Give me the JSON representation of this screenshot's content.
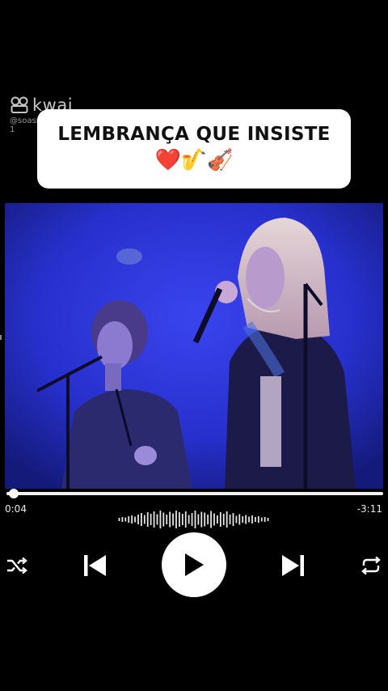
{
  "watermark": {
    "brand": "kwai",
    "handle": "@soasmusicasquemar...",
    "line2": "1"
  },
  "title_card": {
    "title": "LEMBRANÇA QUE INSISTE",
    "emojis": "❤️🎷🎻"
  },
  "player": {
    "elapsed": "0:04",
    "remaining": "-3:11",
    "progress_fraction": 0.02
  },
  "icons": {
    "shuffle": "shuffle-icon",
    "previous": "skip-previous-icon",
    "play": "play-icon",
    "next": "skip-next-icon",
    "repeat": "repeat-icon"
  },
  "colors": {
    "video_stage": "#2a2fd1",
    "background": "#000000"
  }
}
